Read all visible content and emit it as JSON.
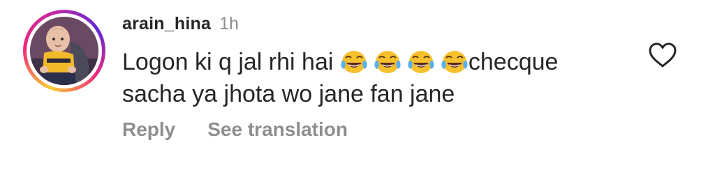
{
  "comment": {
    "username": "arain_hina",
    "timestamp": "1h",
    "text_before_emoji": "Logon ki q jal rhi hai ",
    "emoji": [
      "face-with-tears-of-joy",
      "face-with-tears-of-joy",
      "face-with-tears-of-joy",
      "face-with-tears-of-joy"
    ],
    "text_after_emoji": "checque",
    "text_line2": "sacha ya jhota wo jane fan jane"
  },
  "actions": {
    "reply_label": "Reply",
    "translation_label": "See translation"
  },
  "icons": {
    "like": "heart-outline-icon"
  },
  "colors": {
    "text_primary": "#262626",
    "text_secondary": "#8e8e8e",
    "emoji_face": "#f7c02d",
    "emoji_tears": "#5ab0ee"
  }
}
